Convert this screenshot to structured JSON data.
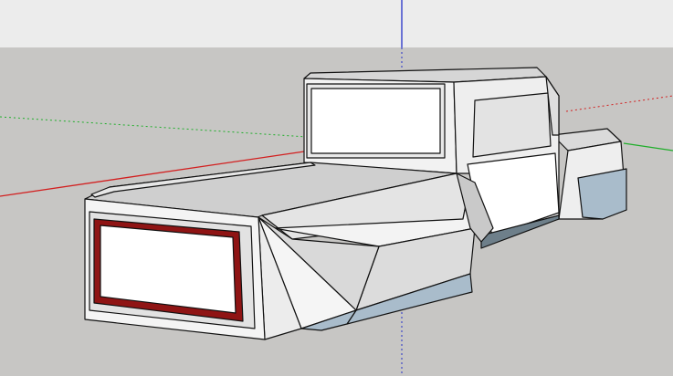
{
  "viewport": {
    "sky_color": "#ececec",
    "ground_color": "#c7c6c4",
    "axis_colors": {
      "red": "#d21f1f",
      "green": "#1fae2a",
      "blue": "#2530c8"
    }
  },
  "model": {
    "face_light": "#f4f4f4",
    "face_mid": "#dadada",
    "face_shadow": "#a9bccb",
    "edge_color": "#111111",
    "taillight_color": "#8f1414",
    "glass_color": "#ffffff"
  }
}
